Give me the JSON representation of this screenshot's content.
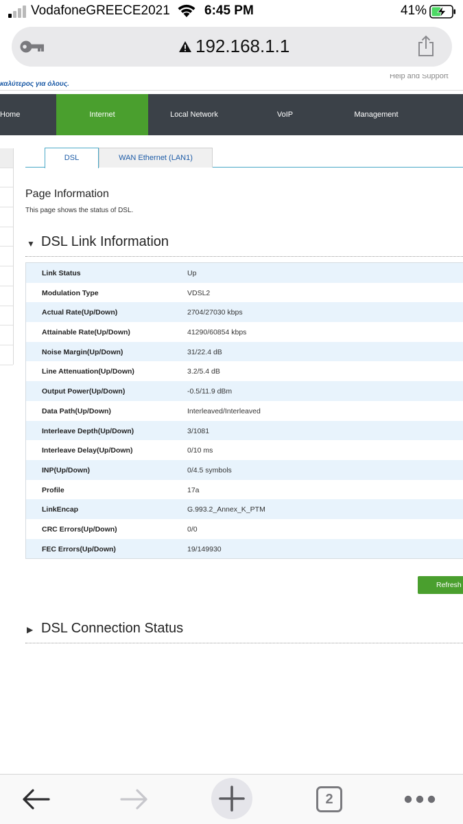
{
  "status_bar": {
    "carrier": "VodafoneGREECE2021",
    "time": "6:45 PM",
    "battery": "41%"
  },
  "url_bar": {
    "url": "192.168.1.1"
  },
  "router": {
    "brand_tagline": "καλύτερος για όλους.",
    "help_link": "Help and Support",
    "nav": [
      "Home",
      "Internet",
      "Local Network",
      "VoIP",
      "Management"
    ],
    "tabs": [
      "DSL",
      "WAN Ethernet (LAN1)"
    ],
    "page_info_title": "Page Information",
    "page_info_desc": "This page shows the status of DSL.",
    "section_link_title": "DSL Link Information",
    "section_conn_title": "DSL Connection Status",
    "rows": [
      {
        "k": "Link Status",
        "v": "Up"
      },
      {
        "k": "Modulation Type",
        "v": "VDSL2"
      },
      {
        "k": "Actual Rate(Up/Down)",
        "v": "2704/27030 kbps"
      },
      {
        "k": "Attainable Rate(Up/Down)",
        "v": "41290/60854 kbps"
      },
      {
        "k": "Noise Margin(Up/Down)",
        "v": "31/22.4 dB"
      },
      {
        "k": "Line Attenuation(Up/Down)",
        "v": "3.2/5.4 dB"
      },
      {
        "k": "Output Power(Up/Down)",
        "v": "-0.5/11.9 dBm"
      },
      {
        "k": "Data Path(Up/Down)",
        "v": "Interleaved/Interleaved"
      },
      {
        "k": "Interleave Depth(Up/Down)",
        "v": "3/1081"
      },
      {
        "k": "Interleave Delay(Up/Down)",
        "v": "0/10 ms"
      },
      {
        "k": "INP(Up/Down)",
        "v": "0/4.5 symbols"
      },
      {
        "k": "Profile",
        "v": "17a"
      },
      {
        "k": "LinkEncap",
        "v": "G.993.2_Annex_K_PTM"
      },
      {
        "k": "CRC Errors(Up/Down)",
        "v": "0/0"
      },
      {
        "k": "FEC Errors(Up/Down)",
        "v": "19/149930"
      }
    ],
    "refresh_label": "Refresh"
  },
  "toolbar": {
    "tabs_count": "2"
  },
  "colors": {
    "nav_bg": "#3b4148",
    "nav_active": "#4a9f2e",
    "tab_accent": "#49a8c7",
    "row_alt": "#e8f3fc",
    "refresh_bg": "#4a9f2e"
  },
  "icons": {
    "signal": "signal-strength-icon",
    "wifi": "wifi-icon",
    "battery": "battery-charging-icon",
    "key": "key-icon",
    "warning": "warning-triangle-icon",
    "share": "share-icon",
    "back": "back-arrow-icon",
    "forward": "forward-arrow-icon",
    "new_tab": "plus-icon",
    "tabs": "tabs-icon",
    "more": "more-dots-icon"
  }
}
